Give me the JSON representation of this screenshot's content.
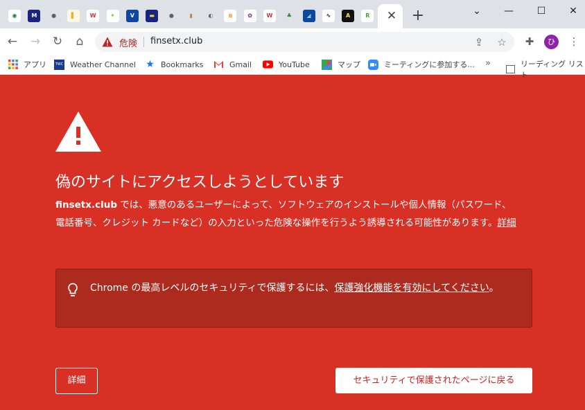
{
  "tabs": {
    "favicons": [
      {
        "name": "tab-favicon-1",
        "glyph": "◉",
        "bg": "#ffffff",
        "fg": "#188038"
      },
      {
        "name": "tab-favicon-2",
        "glyph": "M",
        "bg": "#1a237e",
        "fg": "#ffffff"
      },
      {
        "name": "tab-favicon-3",
        "glyph": "●",
        "bg": "#dee1e6",
        "fg": "#5f6368"
      },
      {
        "name": "tab-favicon-4",
        "glyph": "▌",
        "bg": "#fff8e1",
        "fg": "#f9a825"
      },
      {
        "name": "tab-favicon-5",
        "glyph": "W",
        "bg": "#ffffff",
        "fg": "#d32f2f"
      },
      {
        "name": "tab-favicon-6",
        "glyph": "✦",
        "bg": "#ffffff",
        "fg": "#8bc34a"
      },
      {
        "name": "tab-favicon-7",
        "glyph": "V",
        "bg": "#0d47a1",
        "fg": "#ffffff"
      },
      {
        "name": "tab-favicon-8",
        "glyph": "▬",
        "bg": "#1a237e",
        "fg": "#ffd54f"
      },
      {
        "name": "tab-favicon-9",
        "glyph": "●",
        "bg": "#dee1e6",
        "fg": "#5f6368"
      },
      {
        "name": "tab-favicon-10",
        "glyph": "▮",
        "bg": "#dee1e6",
        "fg": "#b08d57"
      },
      {
        "name": "tab-favicon-11",
        "glyph": "◐",
        "bg": "#dee1e6",
        "fg": "#616161"
      },
      {
        "name": "tab-favicon-12",
        "glyph": "≋",
        "bg": "#ffffff",
        "fg": "#f57c00"
      },
      {
        "name": "tab-favicon-13",
        "glyph": "✿",
        "bg": "#ffffff",
        "fg": "#6a1b9a"
      },
      {
        "name": "tab-favicon-14",
        "glyph": "W",
        "bg": "#ffffff",
        "fg": "#d32f2f"
      },
      {
        "name": "tab-favicon-15",
        "glyph": "♣",
        "bg": "#dee1e6",
        "fg": "#2e7d32"
      },
      {
        "name": "tab-favicon-16",
        "glyph": "◢",
        "bg": "#0d47a1",
        "fg": "#80cbc4"
      },
      {
        "name": "tab-favicon-17",
        "glyph": "∿",
        "bg": "#ffffff",
        "fg": "#111111"
      },
      {
        "name": "tab-favicon-18",
        "glyph": "A",
        "bg": "#111111",
        "fg": "#ffeb3b"
      },
      {
        "name": "tab-favicon-19",
        "glyph": "R",
        "bg": "#ffffff",
        "fg": "#43a047"
      }
    ],
    "active_close": "✕",
    "new_tab": "+"
  },
  "window": {
    "minimize": "⌄",
    "restore": "—",
    "maximize": "☐",
    "close": "✕"
  },
  "toolbar": {
    "back": "←",
    "forward": "→",
    "reload": "↻",
    "home": "⌂",
    "security_label": "危険",
    "url": "finsetx.club",
    "share_glyph": "⇪",
    "star_glyph": "☆",
    "ext_glyph": "✚",
    "menu_glyph": "⋮",
    "avatar_letter": "ひ"
  },
  "bookmarks": [
    {
      "label": "アプリ",
      "icon": "apps-grid-icon"
    },
    {
      "label": "Weather Channel",
      "icon": "weather-channel-icon"
    },
    {
      "label": "Bookmarks",
      "icon": "star-icon"
    },
    {
      "label": "Gmail",
      "icon": "gmail-icon"
    },
    {
      "label": "YouTube",
      "icon": "youtube-icon"
    },
    {
      "label": "マップ",
      "icon": "maps-icon"
    },
    {
      "label": "ミーティングに参加する...",
      "icon": "zoom-icon"
    }
  ],
  "bookmarks_more": "»",
  "reading_list": "リーディング リスト",
  "interstitial": {
    "headline": "偽のサイトにアクセスしようとしています",
    "site": "finsetx.club",
    "body_line1": " では、悪意のあるユーザーによって、ソフトウェアのインストールや個人情報（パスワード、",
    "body_line2": "電話番号、クレジット カードなど）の入力といった危険な操作を行うよう誘導される可能性があります。",
    "details_link": "詳細",
    "enhanced_prefix": "Chrome の最高レベルのセキュリティで保護するには、",
    "enhanced_link": "保護強化機能を有効にしてください",
    "enhanced_suffix": "。",
    "details_button": "詳細",
    "back_button": "セキュリティで保護されたページに戻る"
  }
}
